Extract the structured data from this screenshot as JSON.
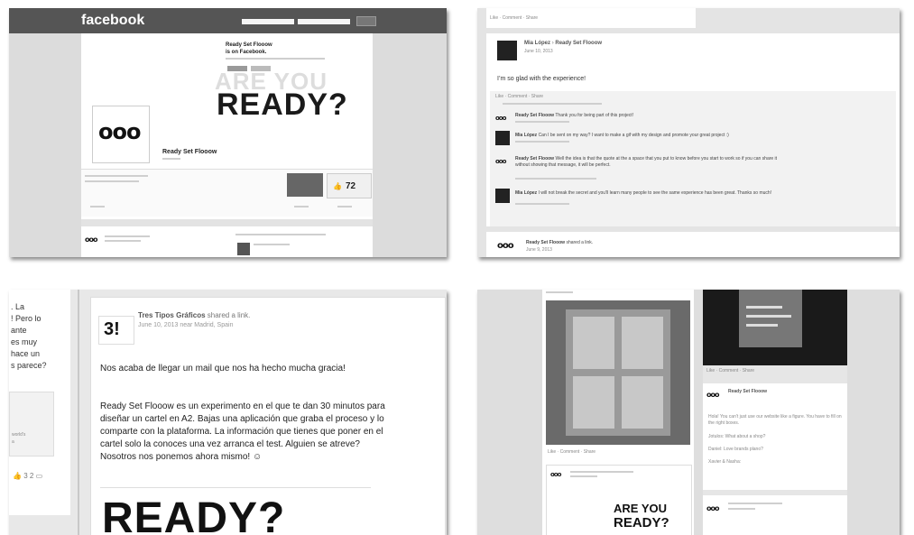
{
  "p1": {
    "brand": "facebook",
    "page_title_line1": "Ready Set Flooow",
    "page_title_line2": "is on Facebook.",
    "poster_are": "ARE YOU",
    "poster_ready": "READY?",
    "ooo": "ooo",
    "page_name": "Ready Set Flooow",
    "like_count": "72"
  },
  "p2": {
    "action_links": "Like · Comment · Share",
    "author": "Mia López",
    "arrow": "›",
    "target": "Ready Set Flooow",
    "date": "June 10, 2013",
    "post_text": "I’m so glad with the experience!",
    "comments": [
      {
        "author": "Ready Set Flooow",
        "text": "Thank you for being part of this project!",
        "avatar": "ooo"
      },
      {
        "author": "Mia López",
        "text": "Can I be sent on my way? I want to make a gif with my design and promote your great project :)",
        "avatar": "photo"
      },
      {
        "author": "Ready Set Flooow",
        "text": "Well the idea is that the quote at the a space that you put to know before you start to work so if you can share it without showing that message, it will be perfect.",
        "avatar": "ooo"
      },
      {
        "author": "Mia López",
        "text": "I will not break the secret and you'll learn many people to see the same experience has been great. Thanks so much!",
        "avatar": "photo"
      }
    ],
    "bottom_author": "Ready Set Flooow",
    "bottom_text": "shared a link.",
    "bottom_date": "June 9, 2013"
  },
  "p3": {
    "left_text": [
      ". La",
      "! Pero lo",
      "ante",
      "es muy",
      "hace un",
      "s parece?"
    ],
    "left_sub": [
      "world's",
      "a"
    ],
    "left_counts": "3  2",
    "author": "Tres Tipos Gráficos",
    "action": "shared a link.",
    "meta": "June 10, 2013 near Madrid, Spain",
    "avatar_text": "3!",
    "para1": "Nos acaba de llegar un mail que nos ha hecho mucha gracia!",
    "para2": "Ready Set Flooow es un experimento en el que te dan 30 minutos para diseñar un cartel en A2. Bajas una aplicación que graba el proceso y lo comparte con la plataforma. La información que tienes que poner en el cartel solo la conoces una vez arranca el test. Alguien se atreve? Nosotros nos ponemos ahora mismo! ☺",
    "poster": "READY?"
  },
  "p4": {
    "are": "ARE YOU",
    "ready": "READY?",
    "action_links": "Like · Comment · Share",
    "comment_author": "Ready Set Flooow",
    "comment_lines": [
      "Hola! You can't just use our website like a figure. You have to fill on the right boxes.",
      "Jotulos: What about a shop?",
      "Daniel: Love brands plano?",
      "Xavier & Nasha:"
    ]
  }
}
